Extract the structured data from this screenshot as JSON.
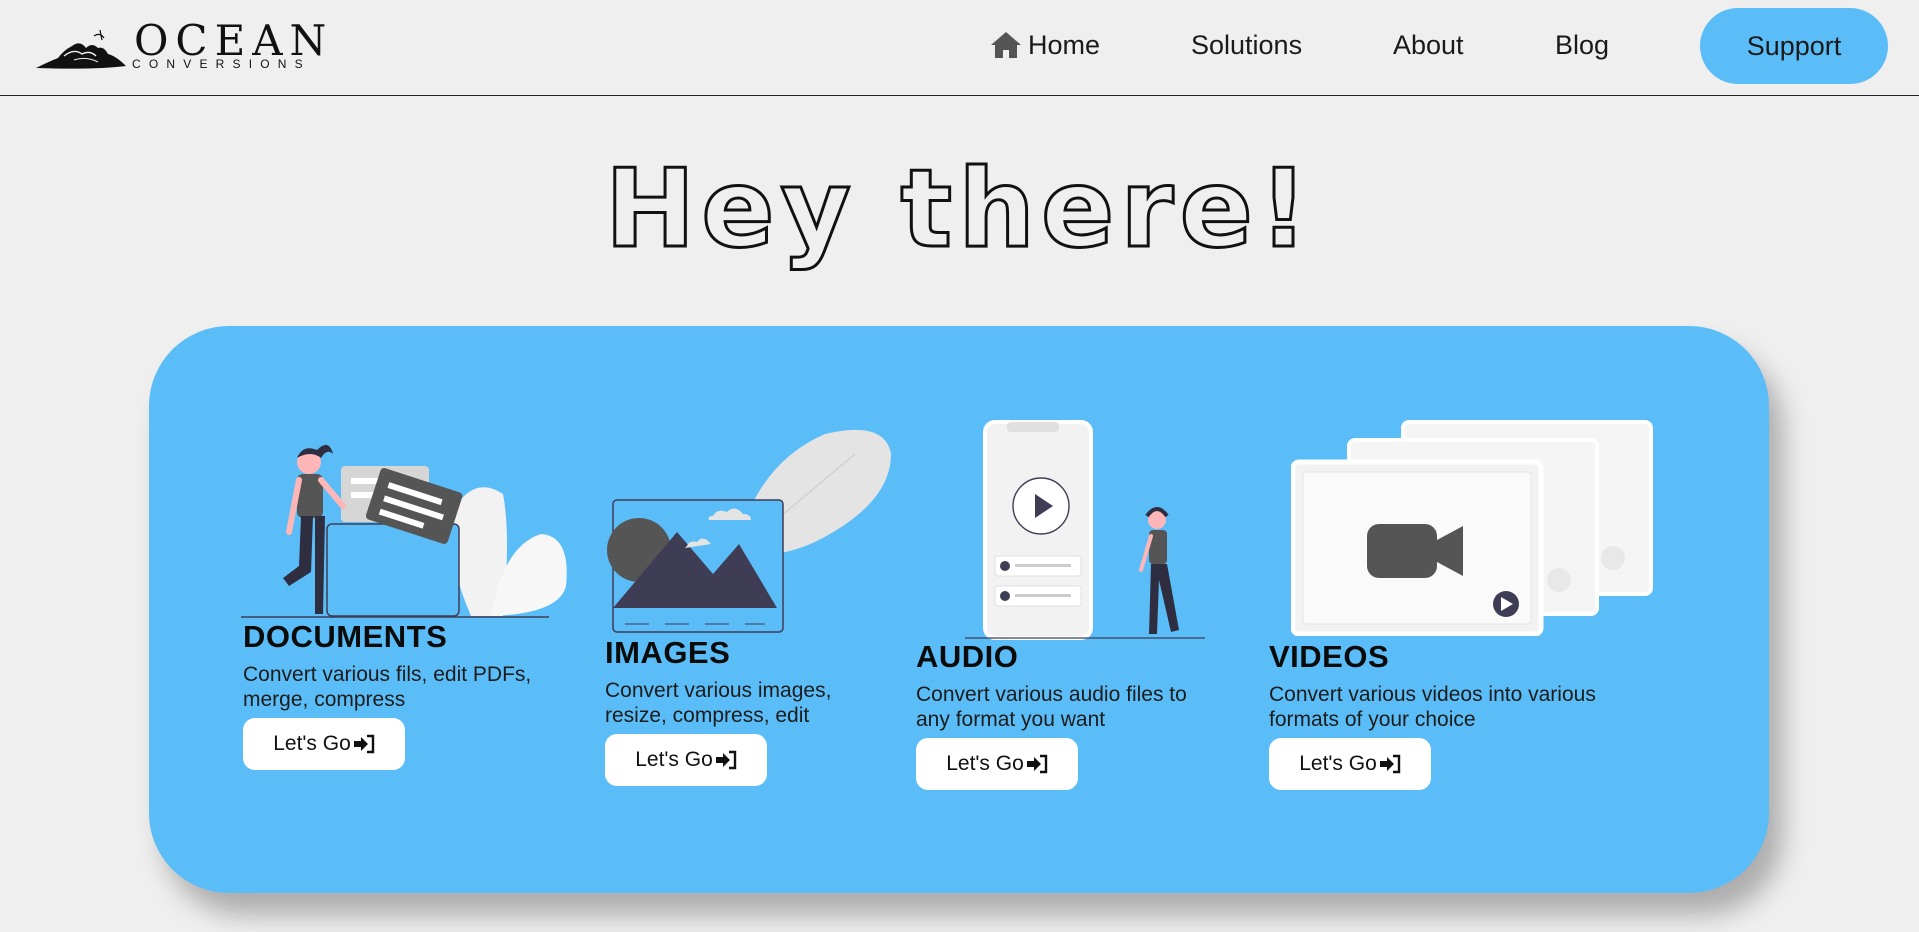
{
  "logo": {
    "word": "OCEAN",
    "sub": "CONVERSIONS"
  },
  "nav": {
    "home": "Home",
    "solutions": "Solutions",
    "about": "About",
    "blog": "Blog",
    "support": "Support"
  },
  "hero": {
    "title": "Hey there!"
  },
  "cards": [
    {
      "title": "DOCUMENTS",
      "desc": "Convert various fils, edit PDFs, merge, compress",
      "button": "Let's Go"
    },
    {
      "title": "IMAGES",
      "desc": "Convert various images, resize, compress, edit",
      "button": "Let's Go"
    },
    {
      "title": "AUDIO",
      "desc": "Convert various audio files to any format you want",
      "button": "Let's Go"
    },
    {
      "title": "VIDEOS",
      "desc": "Convert various videos into various formats of your choice",
      "button": "Let's Go"
    }
  ],
  "colors": {
    "accent": "#5bbdf7",
    "background": "#efefef",
    "dark": "#3f3d56"
  },
  "icons": [
    "home-icon",
    "sign-in-icon"
  ]
}
